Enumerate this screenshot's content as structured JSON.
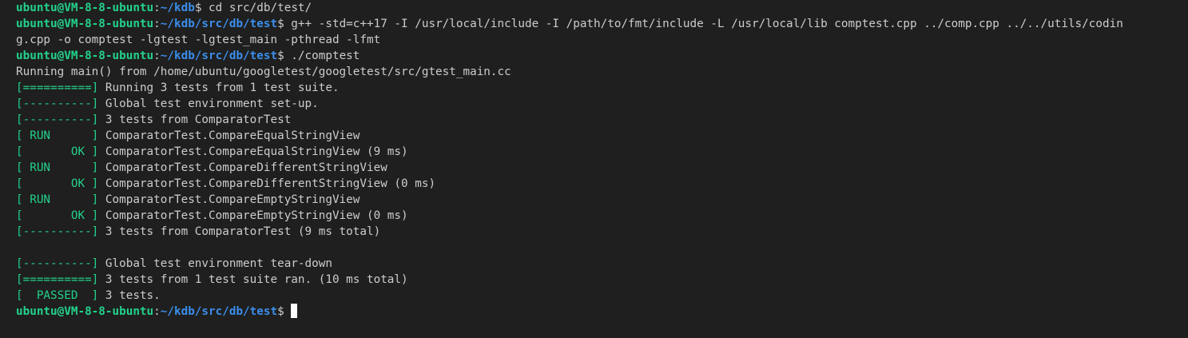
{
  "prompt": {
    "user_host": "ubuntu@VM-8-8-ubuntu",
    "sep": ":",
    "path_kdb": "~/kdb",
    "path_test": "~/kdb/src/db/test",
    "symbol": "$"
  },
  "commands": {
    "cmd1": " cd src/db/test/",
    "cmd2_line1": " g++ -std=c++17 -I /usr/local/include -I /path/to/fmt/include -L /usr/local/lib comptest.cpp ../comp.cpp ../../utils/codin",
    "cmd2_line2": "g.cpp -o comptest -lgtest -lgtest_main -pthread -lfmt",
    "cmd3": " ./comptest"
  },
  "output": {
    "running_main": "Running main() from /home/ubuntu/googletest/googletest/src/gtest_main.cc",
    "l1": {
      "tag": "[==========]",
      "text": " Running 3 tests from 1 test suite."
    },
    "l2": {
      "tag": "[----------]",
      "text": " Global test environment set-up."
    },
    "l3": {
      "tag": "[----------]",
      "text": " 3 tests from ComparatorTest"
    },
    "l4": {
      "tag": "[ RUN      ]",
      "text": " ComparatorTest.CompareEqualStringView"
    },
    "l5": {
      "tag": "[       OK ]",
      "text": " ComparatorTest.CompareEqualStringView (9 ms)"
    },
    "l6": {
      "tag": "[ RUN      ]",
      "text": " ComparatorTest.CompareDifferentStringView"
    },
    "l7": {
      "tag": "[       OK ]",
      "text": " ComparatorTest.CompareDifferentStringView (0 ms)"
    },
    "l8": {
      "tag": "[ RUN      ]",
      "text": " ComparatorTest.CompareEmptyStringView"
    },
    "l9": {
      "tag": "[       OK ]",
      "text": " ComparatorTest.CompareEmptyStringView (0 ms)"
    },
    "l10": {
      "tag": "[----------]",
      "text": " 3 tests from ComparatorTest (9 ms total)"
    },
    "l11": {
      "tag": "[----------]",
      "text": " Global test environment tear-down"
    },
    "l12": {
      "tag": "[==========]",
      "text": " 3 tests from 1 test suite ran. (10 ms total)"
    },
    "l13": {
      "tag": "[  PASSED  ]",
      "text": " 3 tests."
    }
  },
  "colors": {
    "background": "#1f1f1f",
    "foreground": "#cccccc",
    "green": "#23d18b",
    "blue": "#3b8eea",
    "marker": "#3794ff"
  },
  "icons": {
    "command_marker": "command-decoration-dot",
    "cursor": "block-cursor"
  }
}
